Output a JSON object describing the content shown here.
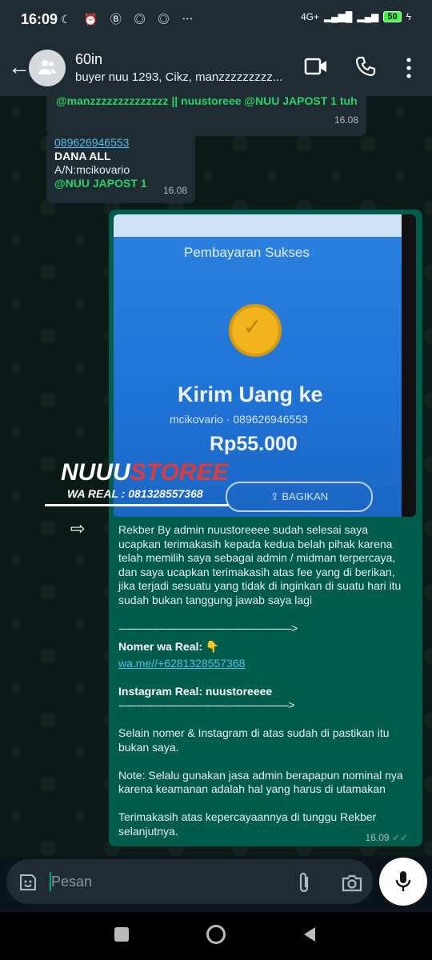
{
  "status_bar": {
    "time": "16:09",
    "network": "4G+",
    "battery": "50"
  },
  "header": {
    "back_icon": "arrow-left-icon",
    "group_name": "60in",
    "participants": "buyer nuu 1293, Cikz, manzzzzzzzzz..."
  },
  "messages": [
    {
      "type": "incoming",
      "text": "@manzzzzzzzzzzzzzz || nuustoreee @NUU JAPOST 1 tuh",
      "time": "16.08"
    },
    {
      "type": "incoming",
      "phone": "089626946553",
      "line2": "DANA ALL",
      "line3": "A/N:mcikovario",
      "mention": "@NUU JAPOST 1",
      "time": "16.08"
    }
  ],
  "image_message": {
    "screen_title": "Pembayaran Sukses",
    "heading": "Kirim Uang ke",
    "recipient": "mcikovario · 089626946553",
    "amount": "Rp55.000",
    "share_label": "BAGIKAN",
    "watermark_main_a": "NUUU",
    "watermark_main_b": "STOREE",
    "watermark_sub": "WA REAL : 081328557368"
  },
  "outgoing_text": {
    "p1": "Rekber By admin nuustoreeee sudah selesai saya ucapkan terimakasih kepada kedua belah pihak karena telah memilih saya sebagai admin / midman terpercaya, dan saya ucapkan terimakasih atas fee yang di berikan, jika terjadi sesuatu yang tidak di inginkan di suatu hari itu sudah bukan tanggung jawab saya lagi",
    "divider1": "----------------------------------------------------------->",
    "wa_label": "Nomer wa Real: 👇",
    "wa_link": "wa.me//+6281328557368",
    "ig_label": "Instagram Real: nuustoreeee",
    "divider2": "---------------------------------------------------------->",
    "p2": "Selain nomer & Instagram di atas sudah di pastikan itu bukan saya.",
    "p3": "Note: Selalu gunakan jasa admin berapapun nominal nya karena keamanan adalah hal yang harus di utamakan",
    "p4": "Terimakasih atas kepercayaannya di tunggu Rekber selanjutnya.",
    "time": "16.09",
    "ticks": "✓✓"
  },
  "composer": {
    "placeholder": "Pesan"
  }
}
